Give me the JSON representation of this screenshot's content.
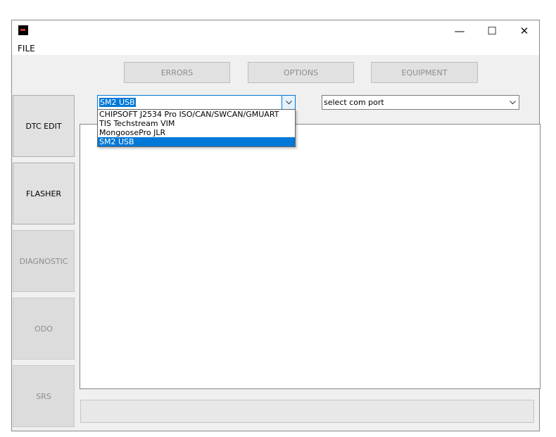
{
  "window": {
    "controls": {
      "minimize": "—",
      "maximize": "☐",
      "close": "✕"
    }
  },
  "menubar": {
    "file": "FILE"
  },
  "top_buttons": {
    "errors": "ERRORS",
    "options": "OPTIONS",
    "equipment": "EQUIPMENT"
  },
  "side_buttons": {
    "dtc_edit": "DTC EDIT",
    "flasher": "FLASHER",
    "diagnostic": "DIAGNOSTIC",
    "odo": "ODO",
    "srs": "SRS"
  },
  "device_select": {
    "value": "SM2 USB",
    "options": [
      "CHIPSOFT J2534 Pro ISO/CAN/SWCAN/GMUART",
      "TIS Techstream VIM",
      "MongoosePro JLR",
      "SM2 USB"
    ],
    "selected_option": "SM2 USB"
  },
  "com_port_select": {
    "value": "select com port"
  },
  "icons": {
    "combo_arrow": "chevron-down-icon",
    "app": "app-icon"
  },
  "colors": {
    "accent": "#0078d7",
    "window_bg": "#f0f0f0",
    "disabled_text": "#8d8d8d"
  }
}
